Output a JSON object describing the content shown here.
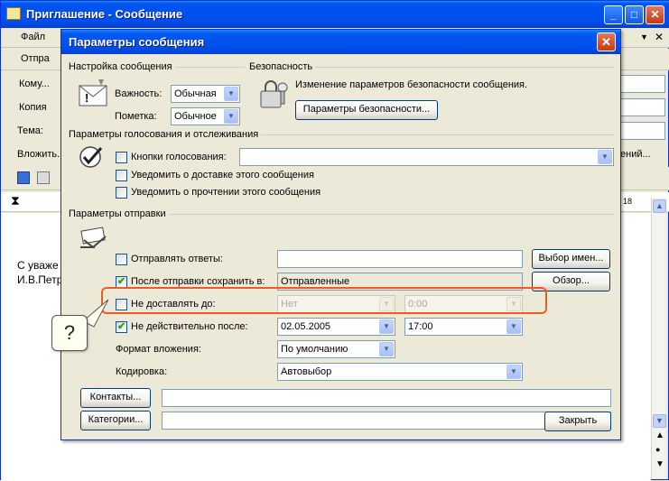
{
  "background_window": {
    "title": "Приглашение - Сообщение",
    "menu": [
      "Файл"
    ],
    "toolbar_send": "Отпра",
    "fields": [
      {
        "label": "Кому..."
      },
      {
        "label": "Копия"
      },
      {
        "label": "Тема:"
      },
      {
        "label": "Вложить..."
      }
    ],
    "right_edge_text": "ений...",
    "font_size": "18",
    "body_lines": [
      "С уваже",
      "И.В.Петр"
    ]
  },
  "dialog": {
    "title": "Параметры сообщения",
    "message_settings": {
      "group_title": "Настройка сообщения",
      "importance_label": "Важность:",
      "importance_value": "Обычная",
      "sensitivity_label": "Пометка:",
      "sensitivity_value": "Обычное"
    },
    "security": {
      "group_title": "Безопасность",
      "description": "Изменение параметров безопасности сообщения.",
      "button": "Параметры безопасности..."
    },
    "voting": {
      "group_title": "Параметры голосования и отслеживания",
      "voting_buttons_label": "Кнопки голосования:",
      "voting_buttons_value": "",
      "delivery_receipt_label": "Уведомить о доставке этого сообщения",
      "read_receipt_label": "Уведомить о прочтении этого сообщения"
    },
    "delivery": {
      "group_title": "Параметры отправки",
      "reply_to_label": "Отправлять ответы:",
      "reply_to_value": "",
      "reply_to_button": "Выбор имен...",
      "save_sent_label": "После отправки сохранить в:",
      "save_sent_value": "Отправленные",
      "save_sent_button": "Обзор...",
      "deliver_after_label": "Не доставлять до:",
      "deliver_after_date": "Нет",
      "deliver_after_time": "0:00",
      "expires_label": "Не действительно после:",
      "expires_date": "02.05.2005",
      "expires_time": "17:00",
      "attachment_format_label": "Формат вложения:",
      "attachment_format_value": "По умолчанию",
      "encoding_label": "Кодировка:",
      "encoding_value": "Автовыбор"
    },
    "contacts_button": "Контакты...",
    "contacts_value": "",
    "categories_button": "Категории...",
    "categories_value": "",
    "close_button": "Закрыть"
  },
  "callout_text": "?",
  "colors": {
    "titlebar": "#0050ee",
    "highlight": "#f05a22",
    "dialog_bg": "#ece9d8"
  },
  "checkboxes": {
    "voting_buttons": false,
    "delivery_receipt": false,
    "read_receipt": false,
    "reply_to": false,
    "save_sent": true,
    "deliver_after": false,
    "expires": true
  }
}
